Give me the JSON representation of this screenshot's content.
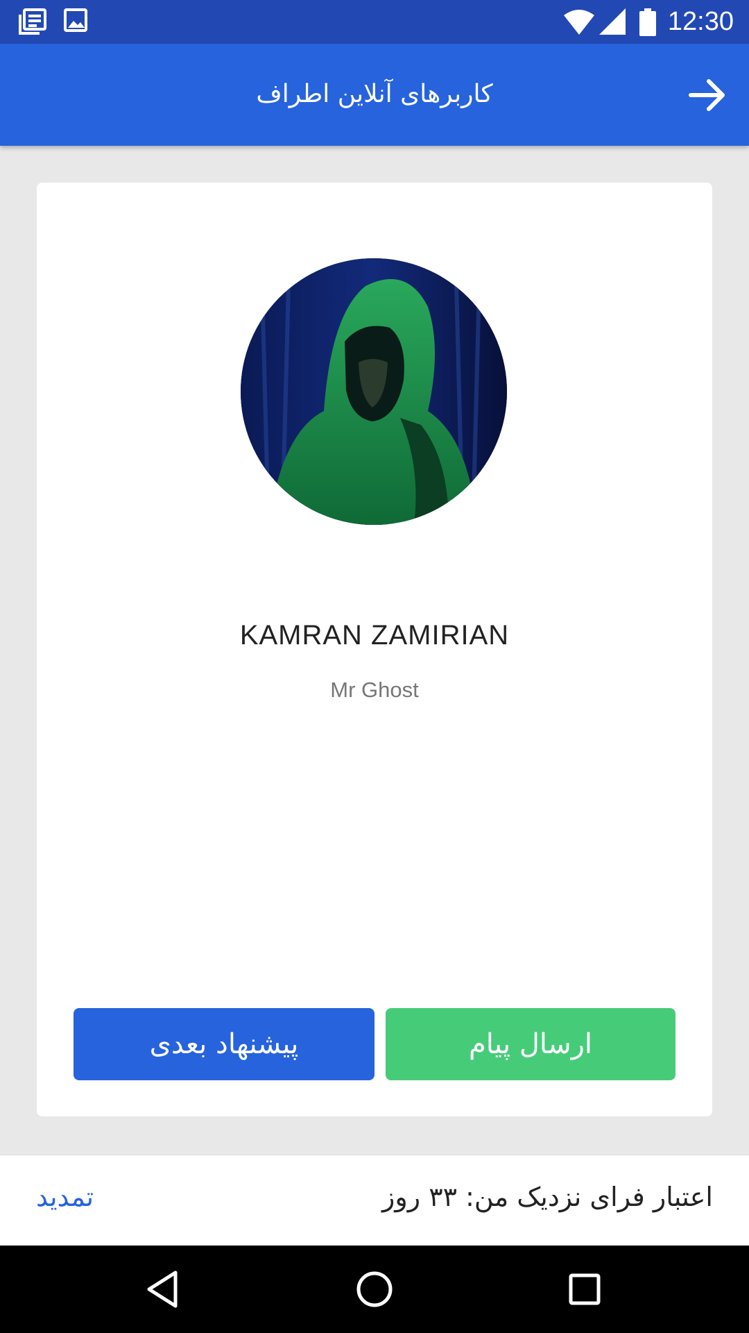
{
  "status_bar": {
    "time": "12:30",
    "icons": [
      "news-icon",
      "image-icon",
      "wifi-icon",
      "signal-icon",
      "battery-icon"
    ]
  },
  "app_bar": {
    "title": "کاربرهای آنلاین اطراف",
    "back_icon": "arrow-right-icon"
  },
  "profile": {
    "name": "KAMRAN ZAMIRIAN",
    "subtitle": "Mr Ghost"
  },
  "actions": {
    "next_suggestion_label": "پیشنهاد بعدی",
    "send_message_label": "ارسال پیام"
  },
  "footer": {
    "credit_text": "اعتبار فرای نزدیک من: ۳۳ روز",
    "renew_label": "تمدید"
  },
  "nav_bar": {
    "icons": [
      "back-triangle-icon",
      "home-circle-icon",
      "recents-square-icon"
    ]
  },
  "colors": {
    "status_bar": "#2249b3",
    "primary": "#2663dd",
    "success": "#46cc79",
    "background": "#e8e8e8"
  }
}
